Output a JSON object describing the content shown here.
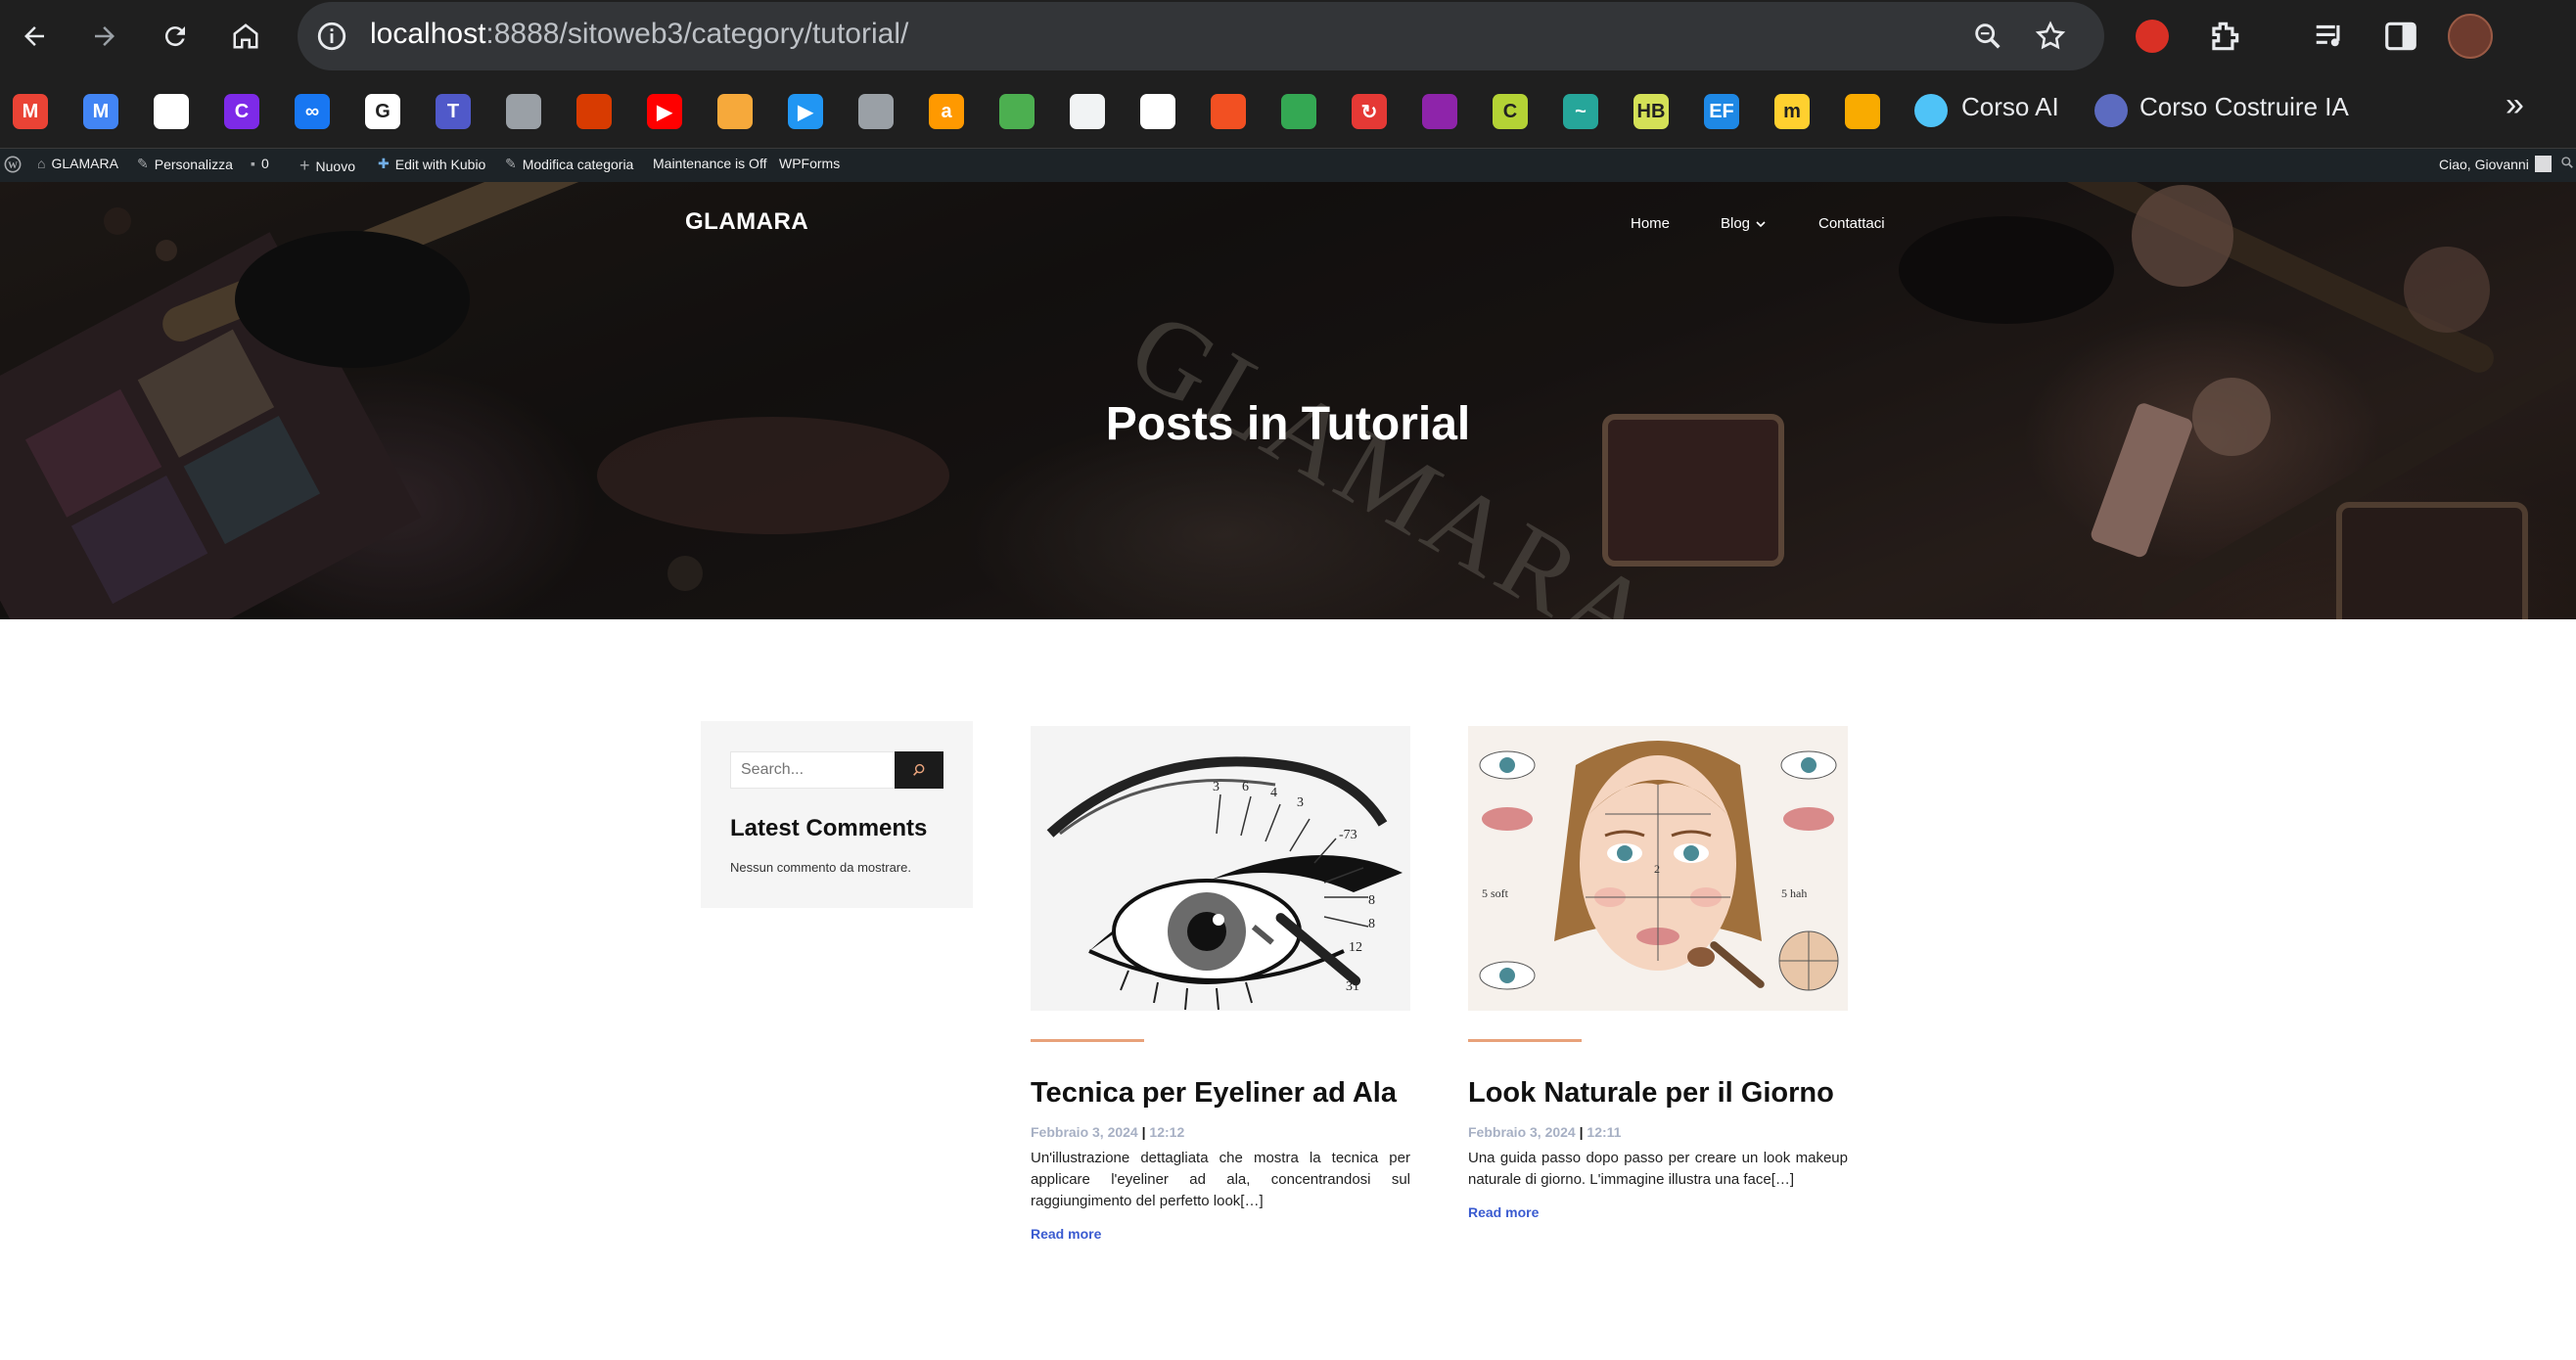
{
  "browser": {
    "url_host": "localhost",
    "url_path": ":8888/sitoweb3/category/tutorial/",
    "bookmarks": [
      {
        "icon": "gmail-icon",
        "color": "#ea4335",
        "glyph": "M"
      },
      {
        "icon": "gmail-icon",
        "color": "#4285f4",
        "glyph": "M"
      },
      {
        "icon": "cloud-icon",
        "color": "#ffffff",
        "glyph": ""
      },
      {
        "icon": "canva-icon",
        "color": "#7d2ae8",
        "glyph": "C"
      },
      {
        "icon": "meta-icon",
        "color": "#1877f2",
        "glyph": "∞"
      },
      {
        "icon": "google-icon",
        "color": "#ffffff",
        "glyph": "G"
      },
      {
        "icon": "teams-icon",
        "color": "#5059c9",
        "glyph": "T"
      },
      {
        "icon": "globe-icon",
        "color": "#9aa0a6",
        "glyph": ""
      },
      {
        "icon": "office-icon",
        "color": "#d83b01",
        "glyph": ""
      },
      {
        "icon": "youtube-icon",
        "color": "#ff0000",
        "glyph": "▶"
      },
      {
        "icon": "lens-icon",
        "color": "#f6a93b",
        "glyph": ""
      },
      {
        "icon": "play-icon",
        "color": "#2196f3",
        "glyph": "▶"
      },
      {
        "icon": "globe-icon",
        "color": "#9aa0a6",
        "glyph": ""
      },
      {
        "icon": "amazon-icon",
        "color": "#ff9900",
        "glyph": "a"
      },
      {
        "icon": "gift-icon",
        "color": "#4caf50",
        "glyph": ""
      },
      {
        "icon": "chrome-icon",
        "color": "#f1f3f4",
        "glyph": ""
      },
      {
        "icon": "document-icon",
        "color": "#ffffff",
        "glyph": ""
      },
      {
        "icon": "microsoft-icon",
        "color": "#f25022",
        "glyph": ""
      },
      {
        "icon": "drive-icon",
        "color": "#34a853",
        "glyph": ""
      },
      {
        "icon": "sync-icon",
        "color": "#e53935",
        "glyph": "↻"
      },
      {
        "icon": "blob-icon",
        "color": "#8e24aa",
        "glyph": ""
      },
      {
        "icon": "c-icon",
        "color": "#b4d335",
        "glyph": "C"
      },
      {
        "icon": "chart-line-icon",
        "color": "#26a69a",
        "glyph": "~"
      },
      {
        "icon": "hb-icon",
        "color": "#d4e157",
        "glyph": "HB"
      },
      {
        "icon": "ef-icon",
        "color": "#1e88e5",
        "glyph": "EF"
      },
      {
        "icon": "miro-icon",
        "color": "#ffd02f",
        "glyph": "m"
      },
      {
        "icon": "analytics-icon",
        "color": "#f9ab00",
        "glyph": ""
      }
    ],
    "named_bookmarks": [
      {
        "icon": "corso-ai-icon",
        "label": "Corso AI",
        "color": "#4fc3f7"
      },
      {
        "icon": "corso-ia-icon",
        "label": "Corso Costruire IA",
        "color": "#5c6bc0"
      }
    ]
  },
  "wpadmin": {
    "site": "GLAMARA",
    "customize": "Personalizza",
    "comments": "0",
    "new": "Nuovo",
    "kubio": "Edit with Kubio",
    "edit_category": "Modifica categoria",
    "maintenance": "Maintenance is Off",
    "wpforms": "WPForms",
    "greeting": "Ciao, Giovanni"
  },
  "site": {
    "logo": "GLAMARA",
    "nav": [
      "Home",
      "Blog",
      "Contattaci"
    ],
    "hero_title": "Posts in Tutorial"
  },
  "sidebar": {
    "search_placeholder": "Search...",
    "widget_title": "Latest Comments",
    "widget_text": "Nessun commento da mostrare."
  },
  "posts": [
    {
      "title": "Tecnica per Eyeliner ad Ala",
      "date": "Febbraio 3, 2024",
      "time": "12:12",
      "excerpt": "Un'illustrazione dettagliata che mostra la tecnica per applicare l'eyeliner ad ala, concentrandosi sul raggiungimento del perfetto look[…]",
      "read_more": "Read more"
    },
    {
      "title": "Look Naturale per il Giorno",
      "date": "Febbraio 3, 2024",
      "time": "12:11",
      "excerpt": "Una guida passo dopo passo per creare un look makeup naturale di giorno. L'immagine illustra una face[…]",
      "read_more": "Read more"
    }
  ]
}
